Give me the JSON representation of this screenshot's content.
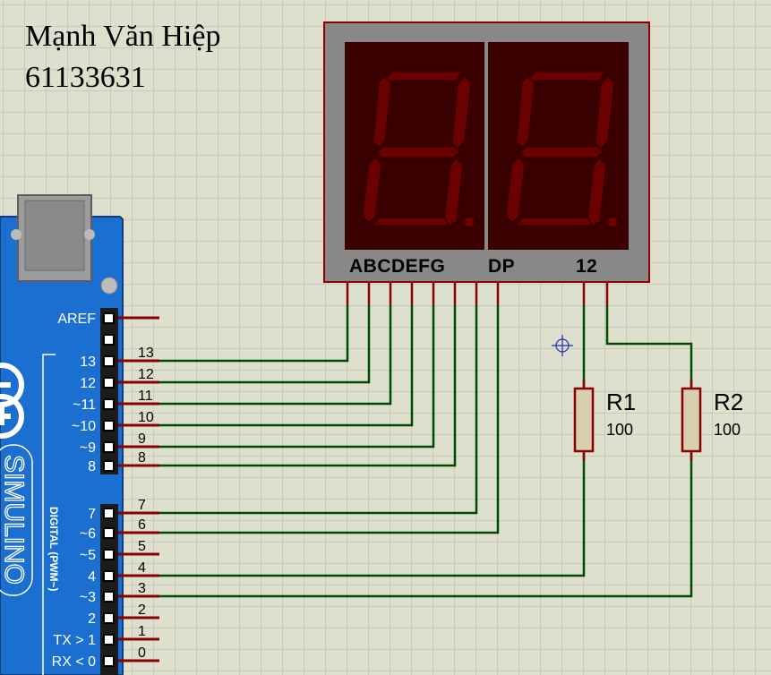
{
  "author": {
    "name": "Mạnh Văn Hiệp",
    "id": "61133631"
  },
  "arduino": {
    "brand": "SIMULINO",
    "digital_label": "DIGITAL (PWM~)",
    "aref_label": "AREF",
    "pins": [
      {
        "board": "13",
        "wire": "13"
      },
      {
        "board": "12",
        "wire": "12"
      },
      {
        "board": "~11",
        "wire": "11"
      },
      {
        "board": "~10",
        "wire": "10"
      },
      {
        "board": "~9",
        "wire": "9"
      },
      {
        "board": "8",
        "wire": "8"
      },
      {
        "board": "7",
        "wire": "7"
      },
      {
        "board": "~6",
        "wire": "6"
      },
      {
        "board": "~5",
        "wire": "5"
      },
      {
        "board": "4",
        "wire": "4"
      },
      {
        "board": "~3",
        "wire": "3"
      },
      {
        "board": "2",
        "wire": "2"
      },
      {
        "board": "TX > 1",
        "wire": "1"
      },
      {
        "board": "RX < 0",
        "wire": "0"
      }
    ]
  },
  "display": {
    "segment_label": "ABCDEFG",
    "dp_label": "DP",
    "digit_label": "12",
    "colors": {
      "frame": "#888888",
      "segment_off": "#6a0000",
      "window": "#3a0000"
    }
  },
  "resistors": [
    {
      "name": "R1",
      "value": "100"
    },
    {
      "name": "R2",
      "value": "100"
    }
  ],
  "colors": {
    "wire": "#004d00",
    "pin": "#8b0000",
    "board": "#1a6fd0",
    "grid": "#dedfcd"
  }
}
